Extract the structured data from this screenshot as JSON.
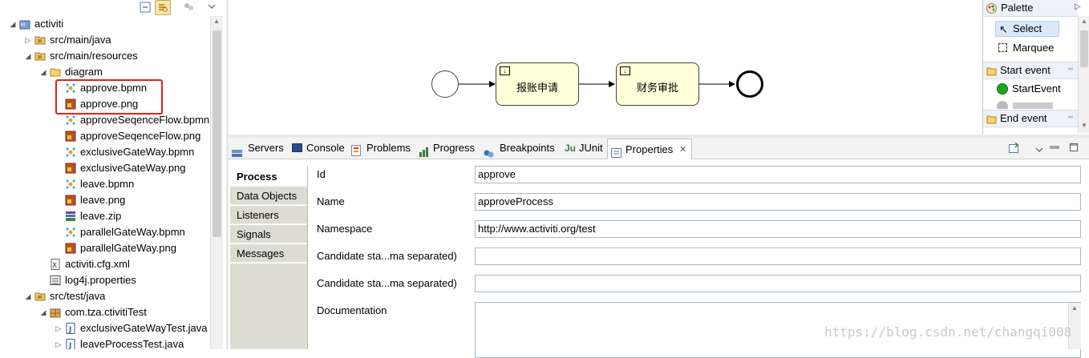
{
  "explorer": {
    "toolbar": {
      "collapse": "collapse-all-icon",
      "link": "link-with-editor-icon",
      "filter": "filter-icon",
      "menu": "view-menu-icon"
    },
    "tree": [
      {
        "label": "activiti",
        "icon": "project",
        "indent": 0,
        "arrow": "down"
      },
      {
        "label": "src/main/java",
        "icon": "srcfolder",
        "indent": 1,
        "arrow": "right"
      },
      {
        "label": "src/main/resources",
        "icon": "srcfolder",
        "indent": 1,
        "arrow": "down"
      },
      {
        "label": "diagram",
        "icon": "folder",
        "indent": 2,
        "arrow": "down"
      },
      {
        "label": "approve.bpmn",
        "icon": "bpmn",
        "indent": 3,
        "arrow": ""
      },
      {
        "label": "approve.png",
        "icon": "png",
        "indent": 3,
        "arrow": ""
      },
      {
        "label": "approveSeqenceFlow.bpmn",
        "icon": "bpmn",
        "indent": 3,
        "arrow": ""
      },
      {
        "label": "approveSeqenceFlow.png",
        "icon": "png",
        "indent": 3,
        "arrow": ""
      },
      {
        "label": "exclusiveGateWay.bpmn",
        "icon": "bpmn",
        "indent": 3,
        "arrow": ""
      },
      {
        "label": "exclusiveGateWay.png",
        "icon": "png",
        "indent": 3,
        "arrow": ""
      },
      {
        "label": "leave.bpmn",
        "icon": "bpmn",
        "indent": 3,
        "arrow": ""
      },
      {
        "label": "leave.png",
        "icon": "png",
        "indent": 3,
        "arrow": ""
      },
      {
        "label": "leave.zip",
        "icon": "zip",
        "indent": 3,
        "arrow": ""
      },
      {
        "label": "parallelGateWay.bpmn",
        "icon": "bpmn",
        "indent": 3,
        "arrow": ""
      },
      {
        "label": "parallelGateWay.png",
        "icon": "png",
        "indent": 3,
        "arrow": ""
      },
      {
        "label": "activiti.cfg.xml",
        "icon": "xml",
        "indent": 2,
        "arrow": ""
      },
      {
        "label": "log4j.properties",
        "icon": "props",
        "indent": 2,
        "arrow": ""
      },
      {
        "label": "src/test/java",
        "icon": "srcfolder",
        "indent": 1,
        "arrow": "down"
      },
      {
        "label": "com.tza.ctivitiTest",
        "icon": "package",
        "indent": 2,
        "arrow": "down"
      },
      {
        "label": "exclusiveGateWayTest.java",
        "icon": "java",
        "indent": 3,
        "arrow": "right"
      },
      {
        "label": "leaveProcessTest.java",
        "icon": "java",
        "indent": 3,
        "arrow": "right"
      }
    ]
  },
  "diagram": {
    "tasks": [
      {
        "label": "报账申请"
      },
      {
        "label": "财务审批"
      }
    ],
    "start_event": "start-event-icon",
    "end_event": "end-event-icon"
  },
  "palette": {
    "title": "Palette",
    "select": "Select",
    "marquee": "Marquee",
    "start_group": "Start event",
    "start_item": "StartEvent",
    "end_group": "End event",
    "colors": {
      "start_event": "#1ea51e",
      "header": "#eef2f8"
    }
  },
  "views": {
    "tabs": [
      "Servers",
      "Console",
      "Problems",
      "Progress",
      "Breakpoints",
      "JUnit",
      "Properties"
    ],
    "active": "Properties"
  },
  "properties": {
    "tabs": [
      "Process",
      "Data Objects",
      "Listeners",
      "Signals",
      "Messages"
    ],
    "active_tab": "Process",
    "fields": [
      {
        "label": "Id",
        "value": "approve"
      },
      {
        "label": "Name",
        "value": "approveProcess"
      },
      {
        "label": "Namespace",
        "value": "http://www.activiti.org/test"
      },
      {
        "label": "Candidate sta...ma separated)",
        "value": ""
      },
      {
        "label": "Candidate sta...ma separated)",
        "value": ""
      },
      {
        "label": "Documentation",
        "value": ""
      }
    ]
  },
  "watermark": "https://blog.csdn.net/changqi008"
}
